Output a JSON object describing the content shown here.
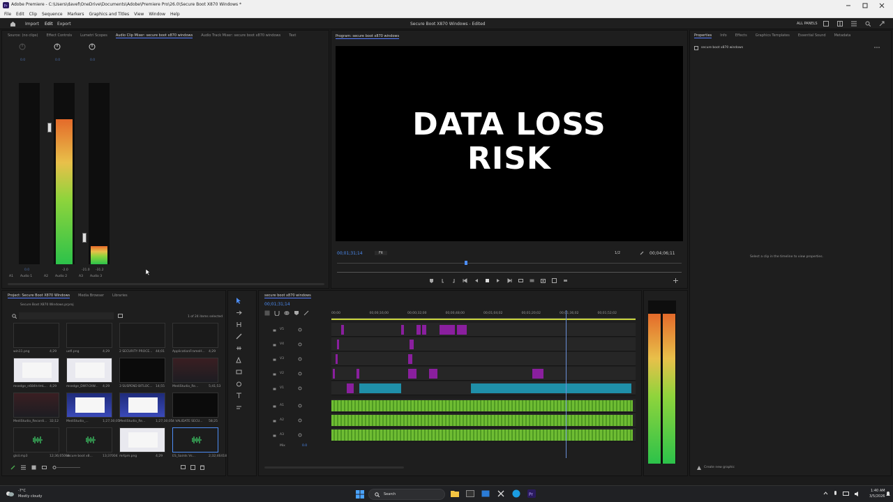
{
  "window": {
    "title": "Adobe Premiere - C:\\Users\\davef\\OneDrive\\Documents\\Adobe\\Premiere Pro\\26.0\\Secure Boot X870 Windows *",
    "menus": [
      "File",
      "Edit",
      "Clip",
      "Sequence",
      "Markers",
      "Graphics and Titles",
      "View",
      "Window",
      "Help"
    ]
  },
  "workspace": {
    "tabs": [
      "Import",
      "Edit",
      "Export"
    ],
    "project_title": "Secure Boot X870 Windows - Edited",
    "all_panels": "ALL PANELS"
  },
  "source_panel": {
    "tabs": [
      "Source: (no clips)",
      "Effect Controls",
      "Lumetri Scopes",
      "Audio Clip Mixer: secure boot x870 windows",
      "Audio Track Mixer: secure boot x870 windows",
      "Text"
    ],
    "channels": [
      {
        "value": "0.0",
        "track": "A1",
        "name": "Audio 1",
        "meter_value": "0.0",
        "level": 0
      },
      {
        "value": "0.0",
        "track": "A2",
        "name": "Audio 2",
        "meter_value": "-2.0",
        "level": 0.8
      },
      {
        "value": "0.0",
        "track": "A3",
        "name": "Audio 3",
        "meter_value": "-21.0",
        "level": 0.1
      }
    ],
    "extra_meter_value": "-31.2"
  },
  "program_monitor": {
    "tab": "Program: secure boot x870 windows",
    "line1": "DATA LOSS",
    "line2": "RISK",
    "timecode": "00;01;31;14",
    "fit": "Fit",
    "quality": "1/2",
    "duration": "00;04;06;11",
    "playhead_fraction": 0.37
  },
  "properties_panel": {
    "tabs": [
      "Properties",
      "Info",
      "Effects",
      "Graphics Templates",
      "Essential Sound",
      "Metadata"
    ],
    "item": "secure boot x870 windows",
    "hint": "Select a clip in the timeline to view properties.",
    "footer": "Create new graphic"
  },
  "project_panel": {
    "tabs": [
      "Project: Secure Boot X870 Windows",
      "Media Browser",
      "Libraries"
    ],
    "path": "Secure Boot X870 Windows.prproj",
    "selection_info": "1 of 24 items selected",
    "items": [
      {
        "name": "win11.png",
        "dur": "4;29",
        "kind": "blank"
      },
      {
        "name": "uefi.png",
        "dur": "4;29",
        "kind": "blank"
      },
      {
        "name": "2 SECURITY PROCE...",
        "dur": "44;01",
        "kind": "blank"
      },
      {
        "name": "ApplicationFrameH...",
        "dur": "4;29",
        "kind": "blank"
      },
      {
        "name": "msedge_n684hrImL...",
        "dur": "4;29",
        "kind": "doc"
      },
      {
        "name": "msedge_DW7r2tW...",
        "dur": "4;29",
        "kind": "doc"
      },
      {
        "name": "3 SUSPEND BITLOC...",
        "dur": "14;55",
        "kind": "dark"
      },
      {
        "name": "MediStudio_Re...",
        "dur": "5;41;53",
        "kind": "red"
      },
      {
        "name": "MediStudio_Recordi...",
        "dur": "32;12",
        "kind": "red"
      },
      {
        "name": "MediStudio_...",
        "dur": "1;27;30;05",
        "kind": "win"
      },
      {
        "name": "MediStudio_Re...",
        "dur": "1;27;30;05",
        "kind": "win"
      },
      {
        "name": "4 VALIDATE SECU...",
        "dur": "58;25",
        "kind": "dark"
      },
      {
        "name": "glsil.mp3",
        "dur": "12;36;05004",
        "kind": "audio"
      },
      {
        "name": "secure boot x8...",
        "dur": "13;37004",
        "kind": "audio"
      },
      {
        "name": "mrtpm.png",
        "dur": "4;29",
        "kind": "doc"
      },
      {
        "name": "ES_Saints Vs...",
        "dur": "2;32;46418",
        "kind": "audio"
      }
    ]
  },
  "timeline": {
    "tab": "secure boot x870 windows",
    "timecode": "00;01;31;14",
    "ruler": [
      "00;00",
      "00;00;16;00",
      "00;00;32;00",
      "00;00;48;00",
      "00;01;04;02",
      "00;01;20;02",
      "00;01;36;02",
      "00;01;52;02"
    ],
    "video_tracks": [
      "V5",
      "V4",
      "V3",
      "V2",
      "V1"
    ],
    "audio_tracks": [
      "A1",
      "A2",
      "A3"
    ],
    "mix_label": "Mix",
    "mix_value": "0.0",
    "playhead_fraction": 0.77
  },
  "master_meter": {
    "level": 0.92
  },
  "taskbar": {
    "weather_temp": "-7°C",
    "weather_text": "Mostly cloudy",
    "search": "Search",
    "time": "1:40 AM",
    "date": "3/5/2026"
  }
}
